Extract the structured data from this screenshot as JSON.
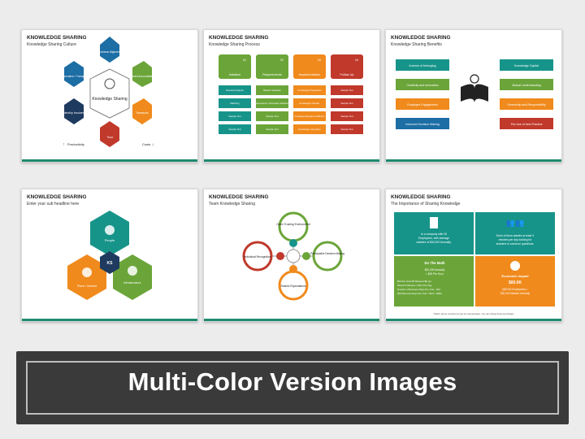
{
  "slides": [
    {
      "title": "KNOWLEDGE SHARING",
      "subtitle": "Knowledge Sharing Culture",
      "center": "Knowledge Sharing",
      "petals": [
        "Business Alignment",
        "Shared Accountability",
        "Teamwork",
        "Trust",
        "Leadership Involvement",
        "Communication / Transparency"
      ],
      "productivity": "Productivity",
      "costs": "Costs"
    },
    {
      "title": "KNOWLEDGE SHARING",
      "subtitle": "Knowledge Sharing Process",
      "steps": [
        {
          "num": "01",
          "label": "Initiation",
          "items": [
            "Demand Analysis",
            "Matching",
            "Sample Text",
            "Sample Text"
          ]
        },
        {
          "num": "02",
          "label": "Requirements",
          "items": [
            "Mission Selection",
            "Governance / Information Selection",
            "Sample Text",
            "Sample Text"
          ]
        },
        {
          "num": "03",
          "label": "Implementation",
          "items": [
            "Knowledge Preparation",
            "Knowledge Transfer",
            "Knowledge Absorption & Utilization",
            "Knowledge Integration"
          ]
        },
        {
          "num": "04",
          "label": "Follow-Up",
          "items": [
            "Sample Text",
            "Sample Text",
            "Sample Text",
            "Sample Text"
          ]
        }
      ]
    },
    {
      "title": "KNOWLEDGE SHARING",
      "subtitle": "Knowledge Sharing Benefits",
      "left": [
        "A sense of belonging",
        "Creativity and innovation",
        "Employee Engagement",
        "Informed Decision Making"
      ],
      "right": [
        "Knowledge Capital",
        "Mutual Understanding",
        "Ownership and Responsibility",
        "The Use of best Practice"
      ]
    },
    {
      "title": "KNOWLEDGE SHARING",
      "subtitle": "Enter your sub headline here",
      "people": "People",
      "place": "Place / Interest",
      "infra": "Infrastructure",
      "center": "KS"
    },
    {
      "title": "KNOWLEDGE SHARING",
      "subtitle": "Team Knowledge Sharing",
      "circles": [
        "Open Trusting Environment",
        "Participative Decision Making",
        "Shared Expectations",
        "Individual Recognition"
      ]
    },
    {
      "title": "KNOWLEDGE SHARING",
      "subtitle": "The Importance of Sharing Knowledge",
      "q1": [
        "In a company with 00",
        "Employees, with average",
        "salaries of $00,000 Annually."
      ],
      "q2": [
        "Each of them wastes at least 0",
        "minutes per day looking for",
        "answers to common questions."
      ],
      "q3_title": "Do The Math",
      "q3": [
        "$00,000 Annually",
        "= $00 Per Hour"
      ],
      "q3_list": [
        "$00 Per Hour/00 Minutes=$0 per",
        "Minute*0 Minutes = $0.0 Per Day",
        "Number of Business Days Per Year - 000",
        "000 Business Days Per Year * $0.0 = $000"
      ],
      "q4_title": "Economic Impact",
      "q4_value": "$00.0K",
      "q4": [
        "($00*00 Employees) =",
        "$00,000 Wasted Annually"
      ],
      "footnote": "*Match, Above numbers are just for representation. You can change those accordingly."
    }
  ],
  "banner": "Multi-Color Version Images",
  "colors": {
    "blue": "#1c6ea4",
    "green": "#6ba539",
    "orange": "#f08a1c",
    "red": "#c0392b",
    "teal": "#17948a",
    "navy": "#1e3a5f"
  }
}
